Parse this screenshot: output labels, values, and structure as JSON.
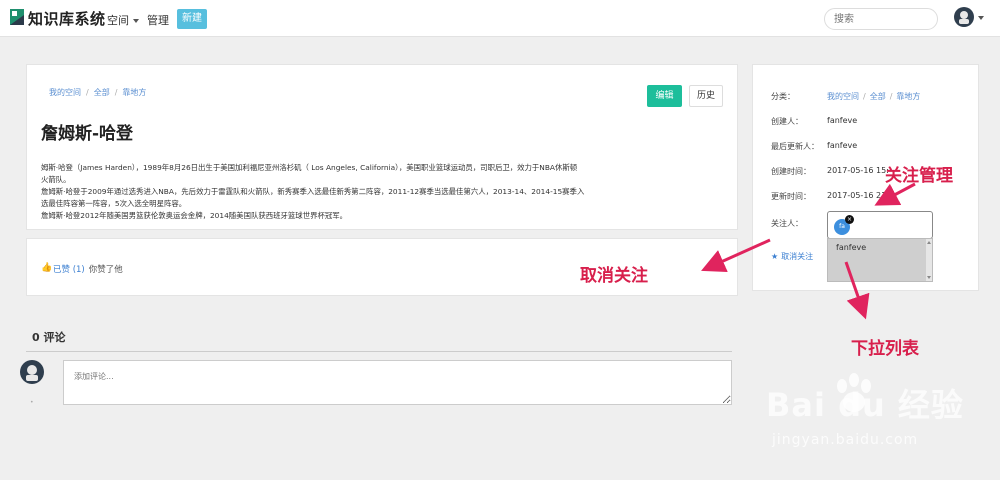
{
  "navbar": {
    "brand": "知识库系统",
    "space_label": "空间",
    "manage_label": "管理",
    "new_label": "新建",
    "search_placeholder": "搜索"
  },
  "article": {
    "breadcrumb": [
      "我的空间",
      "全部",
      "靠地方"
    ],
    "edit_label": "编辑",
    "history_label": "历史",
    "title": "詹姆斯-哈登",
    "paragraphs": [
      "姆斯·哈登（James Harden），1989年8月26日出生于美国加利福尼亚州洛杉矶（ Los Angeles, California），美国职业篮球运动员，司职后卫，效力于NBA休斯顿",
      "火箭队。",
      "詹姆斯·哈登于2009年通过选秀进入NBA，先后效力于雷霆队和火箭队，新秀赛季入选最佳新秀第二阵容，2011-12赛季当选最佳第六人，2013-14、2014-15赛季入",
      "选最佳阵容第一阵容，5次入选全明星阵容。",
      "詹姆斯·哈登2012年随美国男篮获伦敦奥运会金牌，2014随美国队获西班牙篮球世界杯冠军。"
    ]
  },
  "like": {
    "label": "已赞 (1)",
    "extra": "你赞了他"
  },
  "sidebar": {
    "category_label": "分类：",
    "category_path": [
      "我的空间",
      "全部",
      "靠地方"
    ],
    "creator_label": "创建人：",
    "creator": "fanfeve",
    "last_updater_label": "最后更新人：",
    "last_updater": "fanfeve",
    "created_label": "创建时间：",
    "created": "2017-05-16 15:",
    "updated_label": "更新时间：",
    "updated": "2017-05-16 21:0",
    "watchers_label": "关注人：",
    "watcher_chip": "fa",
    "dropdown_item": "fanfeve",
    "unwatch_label": "取消关注"
  },
  "comments": {
    "title": "0 评论",
    "placeholder": "添加评论..."
  },
  "annotations": {
    "manage": "关注管理",
    "cancel": "取消关注",
    "dropdown": "下拉列表"
  },
  "watermark": {
    "main": "Bai du 经验",
    "sub": "jingyan.baidu.com"
  },
  "colors": {
    "primary_button": "#1dbe9b",
    "new_button": "#57bfde",
    "link": "#3b7fd1",
    "annotation": "#d81f4c"
  }
}
